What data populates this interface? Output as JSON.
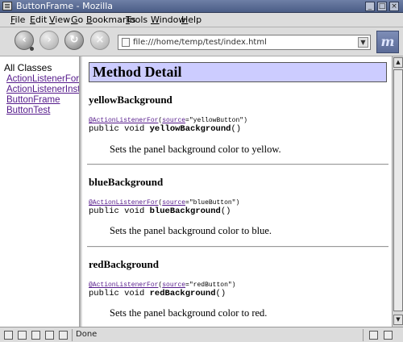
{
  "window": {
    "title": "ButtonFrame - Mozilla",
    "controls": [
      "minimize-icon",
      "maximize-icon",
      "close-icon"
    ]
  },
  "menu": [
    {
      "label": "File",
      "key": "F"
    },
    {
      "label": "Edit",
      "key": "E"
    },
    {
      "label": "View",
      "key": "V"
    },
    {
      "label": "Go",
      "key": "G"
    },
    {
      "label": "Bookmarks",
      "key": "B"
    },
    {
      "label": "Tools",
      "key": "T"
    },
    {
      "label": "Window",
      "key": "W"
    },
    {
      "label": "Help",
      "key": "H"
    }
  ],
  "navigation": {
    "back": "back-arrow-icon",
    "forward": "forward-arrow-icon",
    "reload": "reload-icon",
    "stop": "stop-icon",
    "url": "file:///home/temp/test/index.html",
    "throbber": "m"
  },
  "left_frame": {
    "heading": "All Classes",
    "classes": [
      "ActionListenerFor",
      "ActionListenerInstaller",
      "ButtonFrame",
      "ButtonTest"
    ]
  },
  "right_frame": {
    "section_title": "Method Detail",
    "methods": [
      {
        "name": "yellowBackground",
        "annotation": "@ActionListenerFor",
        "param": "source",
        "value": "\"yellowButton\"",
        "sig_prefix": "public void ",
        "sig_name": "yellowBackground",
        "sig_suffix": "()",
        "description": "Sets the panel background color to yellow."
      },
      {
        "name": "blueBackground",
        "annotation": "@ActionListenerFor",
        "param": "source",
        "value": "\"blueButton\"",
        "sig_prefix": "public void ",
        "sig_name": "blueBackground",
        "sig_suffix": "()",
        "description": "Sets the panel background color to blue."
      },
      {
        "name": "redBackground",
        "annotation": "@ActionListenerFor",
        "param": "source",
        "value": "\"redButton\"",
        "sig_prefix": "public void ",
        "sig_name": "redBackground",
        "sig_suffix": "()",
        "description": "Sets the panel background color to red."
      }
    ]
  },
  "status": {
    "text": "Done"
  },
  "colors": {
    "visited_link": "#551a8b",
    "header_bg": "#ccccff",
    "chrome": "#dcdcdc"
  }
}
